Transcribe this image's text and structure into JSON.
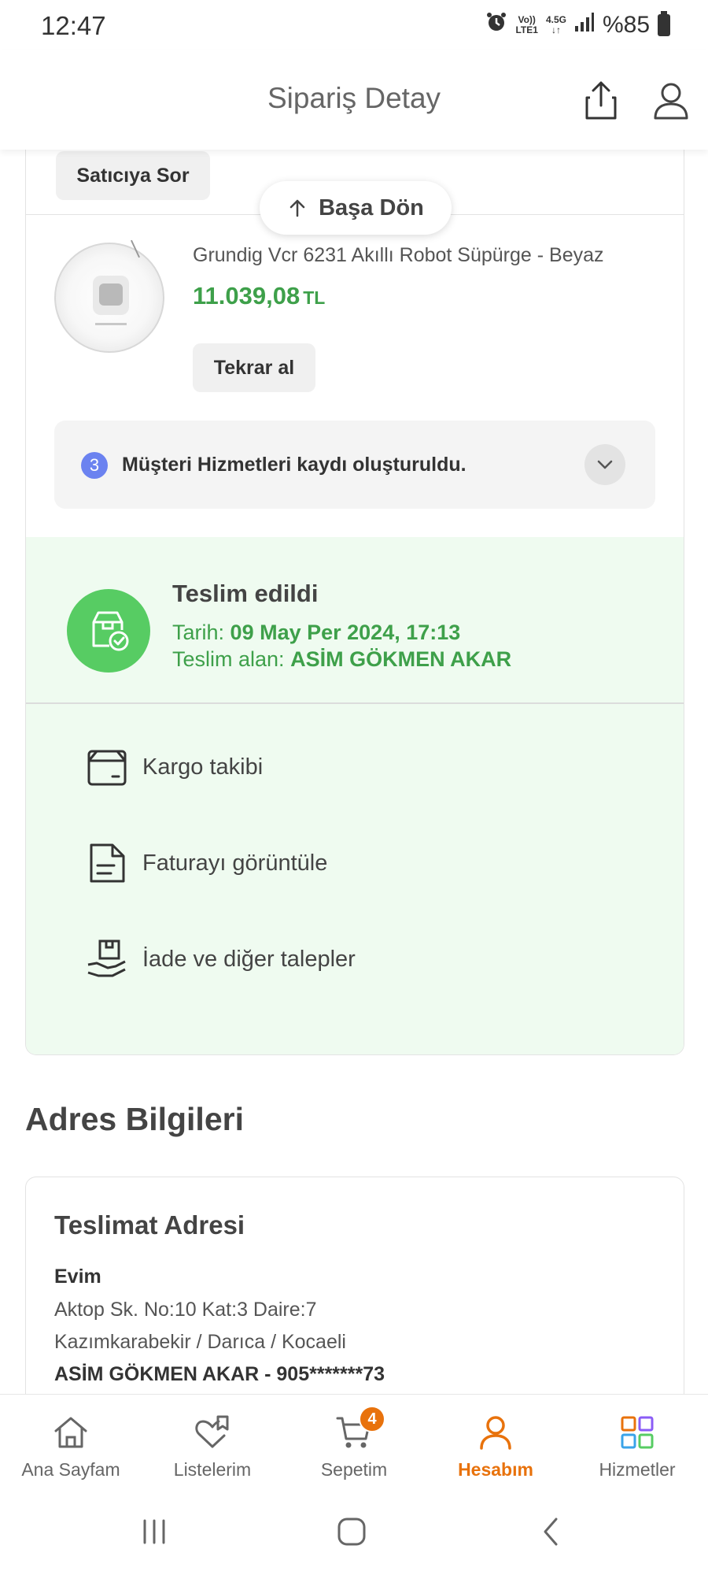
{
  "status_bar": {
    "time": "12:47",
    "network_top": "Vo))",
    "network_bottom": "LTE1",
    "data_type": "4.5G",
    "battery": "%85",
    "icons": [
      "alarm-icon",
      "signal-icon",
      "battery-icon"
    ]
  },
  "header": {
    "title": "Sipariş Detay",
    "icons": [
      "share-icon",
      "profile-icon"
    ]
  },
  "seller": {
    "ask_label": "Satıcıya Sor"
  },
  "back_to_top": {
    "label": "Başa Dön"
  },
  "product": {
    "name": "Grundig Vcr 6231 Akıllı Robot Süpürge - Beyaz",
    "price": "11.039,08",
    "currency": "TL",
    "rebuy_label": "Tekrar al"
  },
  "customer_service": {
    "count": "3",
    "text": "Müşteri Hizmetleri kaydı oluşturuldu."
  },
  "delivery": {
    "status": "Teslim edildi",
    "date_label": "Tarih:",
    "date_value": "09 May Per 2024, 17:13",
    "receiver_label": "Teslim alan:",
    "receiver_value": "ASİM GÖKMEN AKAR"
  },
  "actions": [
    {
      "label": "Kargo takibi",
      "icon": "box-icon"
    },
    {
      "label": "Faturayı görüntüle",
      "icon": "invoice-icon"
    },
    {
      "label": "İade ve diğer talepler",
      "icon": "return-icon"
    }
  ],
  "address": {
    "heading": "Adres Bilgileri",
    "card_title": "Teslimat Adresi",
    "name": "Evim",
    "line1": "Aktop Sk. No:10 Kat:3 Daire:7",
    "line2": "Kazımkarabekir / Darıca / Kocaeli",
    "person": "ASİM GÖKMEN AKAR - 905*******73"
  },
  "bottom_nav": [
    {
      "label": "Ana Sayfam",
      "icon": "home-icon"
    },
    {
      "label": "Listelerim",
      "icon": "list-heart-icon"
    },
    {
      "label": "Sepetim",
      "icon": "cart-icon",
      "badge": "4"
    },
    {
      "label": "Hesabım",
      "icon": "account-icon",
      "active": true
    },
    {
      "label": "Hizmetler",
      "icon": "services-icon"
    }
  ],
  "colors": {
    "accent_orange": "#e8720c",
    "success_green": "#3ea04a",
    "delivered_bg": "#effbf0",
    "badge_blue": "#6b82f0"
  }
}
